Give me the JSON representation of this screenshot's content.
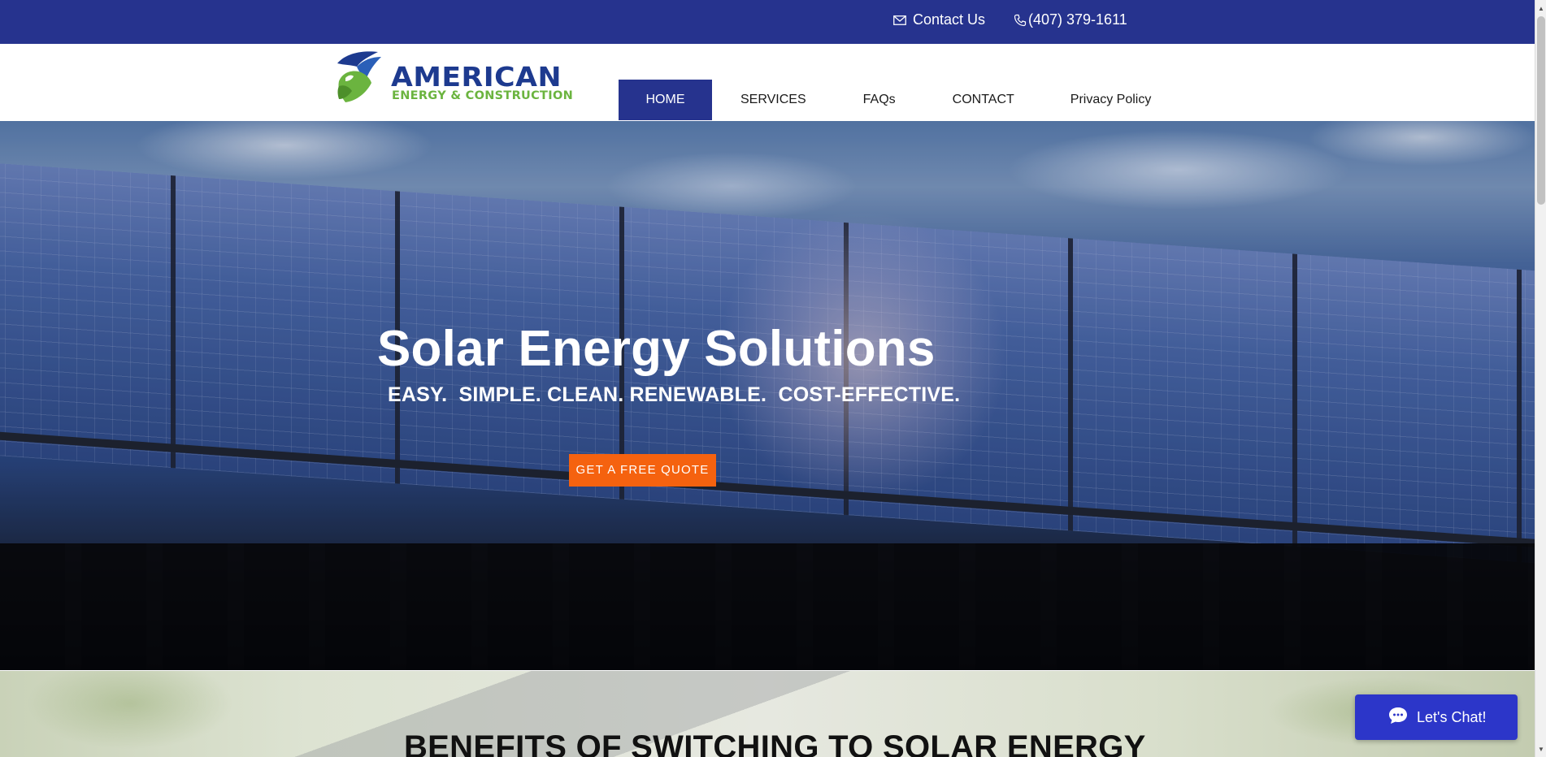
{
  "topbar": {
    "contact_label": "Contact Us",
    "phone": "(407) 379-1611",
    "bg_color": "#26338e"
  },
  "logo": {
    "name": "AMERICAN",
    "tagline": "ENERGY & CONSTRUCTION"
  },
  "nav": {
    "items": [
      {
        "label": "HOME",
        "active": true
      },
      {
        "label": "SERVICES",
        "active": false
      },
      {
        "label": "FAQs",
        "active": false
      },
      {
        "label": "CONTACT",
        "active": false
      },
      {
        "label": "Privacy Policy",
        "active": false
      }
    ]
  },
  "hero": {
    "title": "Solar Energy Solutions",
    "subtitle": "EASY.  SIMPLE. CLEAN. RENEWABLE.  COST-EFFECTIVE.",
    "cta_label": "GET A FREE QUOTE",
    "cta_color": "#f5620f"
  },
  "benefits": {
    "title": "BENEFITS OF SWITCHING TO SOLAR ENERGY"
  },
  "chat": {
    "label": "Let's Chat!",
    "icon": "chat-bubble-icon",
    "color": "#2c36c9"
  },
  "icons": {
    "contact": "mail-icon",
    "phone": "phone-icon"
  }
}
